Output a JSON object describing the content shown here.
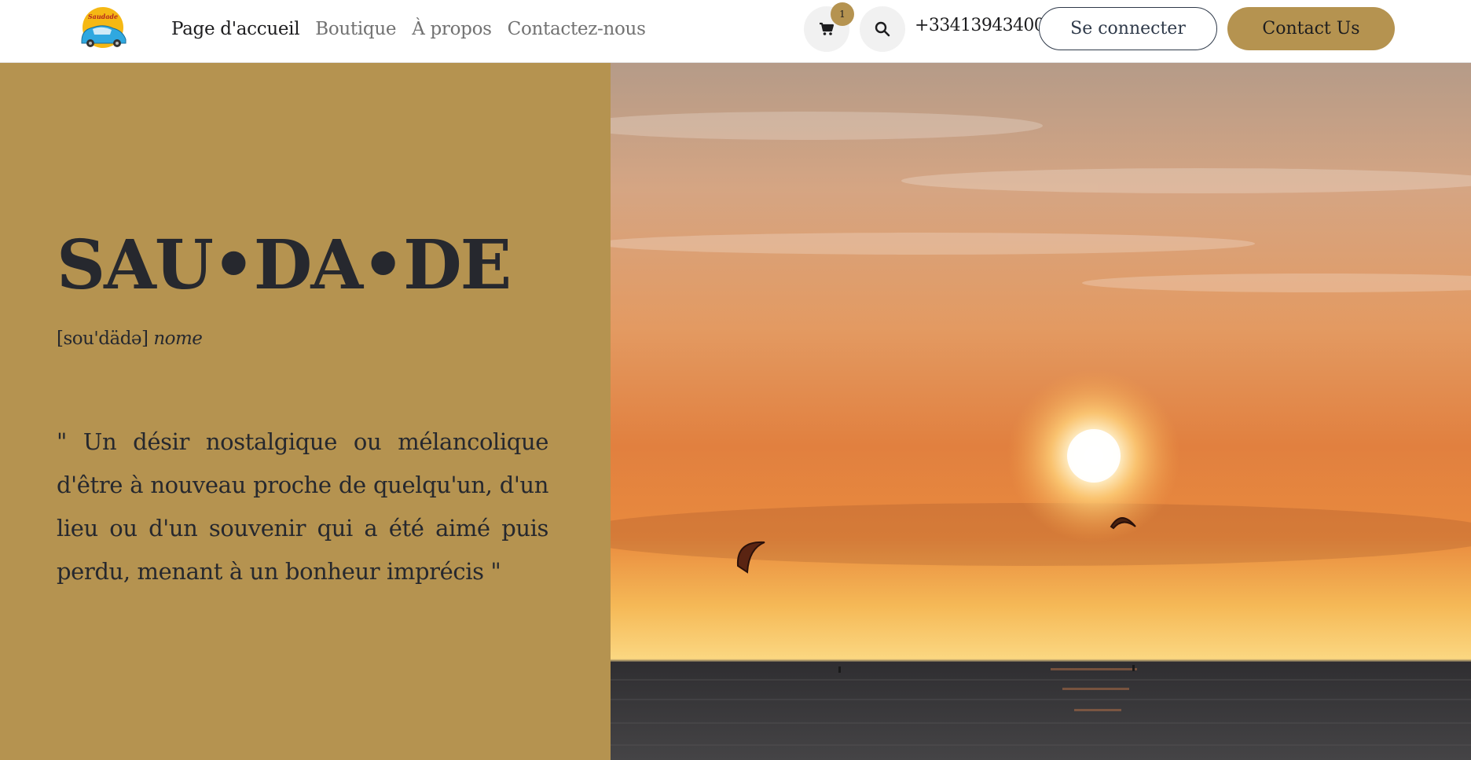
{
  "brand": {
    "logo_text": "Saudade",
    "accent_color": "#b59350"
  },
  "nav": {
    "items": [
      {
        "label": "Page d'accueil",
        "active": true
      },
      {
        "label": "Boutique",
        "active": false
      },
      {
        "label": "À propos",
        "active": false
      },
      {
        "label": "Contactez-nous",
        "active": false
      }
    ]
  },
  "header": {
    "cart_icon": "cart-icon",
    "cart_count": "1",
    "search_icon": "search-icon",
    "phone": "+33413943400",
    "login_label": "Se connecter",
    "contact_label": "Contact Us"
  },
  "hero": {
    "title": "SAU•DA•DE",
    "pronunciation": "[sou'dädə]",
    "word_type": "nome",
    "quote": "\" Un désir nostalgique ou mélancolique d'être à nouveau proche de quelqu'un, d'un lieu ou d'un souvenir qui a été aimé puis perdu, menant à un bonheur imprécis \"",
    "panel_color": "#b59350",
    "image": "sunset-kitesurf-photo"
  }
}
